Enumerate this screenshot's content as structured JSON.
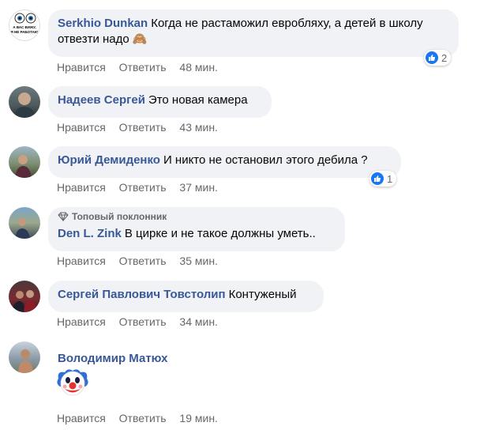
{
  "actions": {
    "like": "Нравится",
    "reply": "Ответить",
    "separator": "·"
  },
  "avatar_text": {
    "line1": "А ВАС ВИЖУ,",
    "line2": "Я НЕ РАБОТАЮ"
  },
  "comments": [
    {
      "author": "Serkhio Dunkan",
      "text": "Когда не растаможил евробляху, а детей в школу отвезти надо",
      "emoji": "🙈",
      "time": "48 мин.",
      "reactions": "2"
    },
    {
      "author": "Надеев Сергей",
      "text": "Это новая камера",
      "time": "43 мин."
    },
    {
      "author": "Юрий Демиденко",
      "text": "И никто не остановил этого дебила ?",
      "time": "37 мин.",
      "reactions": "1"
    },
    {
      "author": "Den L. Zink",
      "badge": "Топовый поклонник",
      "text": "В цирке и не такое должны уметь..",
      "time": "35 мин."
    },
    {
      "author": "Сергей Павлович Товстолип",
      "text": "Контуженый",
      "time": "34 мин."
    },
    {
      "author": "Володимир Матюх",
      "emoji": "🤡",
      "time": "19 мин."
    }
  ],
  "colors": {
    "author": "#385898",
    "bubble": "#f0f2f5",
    "meta": "#65676b",
    "like": "#1877f2"
  }
}
